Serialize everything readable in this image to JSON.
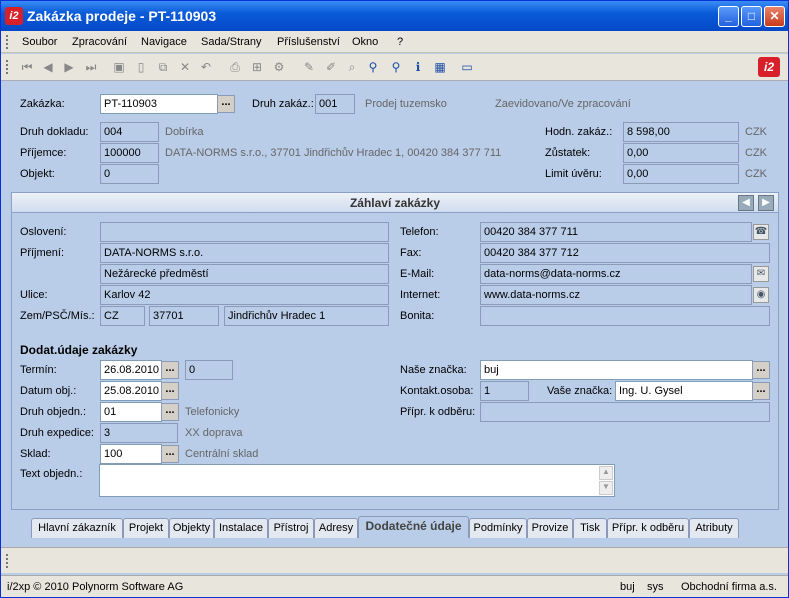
{
  "window": {
    "title": "Zakázka prodeje - PT-110903",
    "logo": "i2"
  },
  "menu": [
    "Soubor",
    "Zpracování",
    "Navigace",
    "Sada/Strany",
    "Příslušenství",
    "Okno",
    "?"
  ],
  "top": {
    "zakazka_label": "Zakázka:",
    "zakazka_value": "PT-110903",
    "druh_zakaz_label": "Druh zakáz.:",
    "druh_zakaz_value": "001",
    "druh_zakaz_text": "Prodej tuzemsko",
    "status_text": "Zaevidovano/Ve zpracování",
    "druh_dokladu_label": "Druh dokladu:",
    "druh_dokladu_value": "004",
    "druh_dokladu_text": "Dobírka",
    "prijemce_label": "Příjemce:",
    "prijemce_value": "100000",
    "prijemce_text": "DATA-NORMS s.r.o., 37701 Jindřichův Hradec 1, 00420 384 377 711",
    "objekt_label": "Objekt:",
    "objekt_value": "0",
    "hodn_label": "Hodn. zakáz.:",
    "hodn_value": "8 598,00",
    "hodn_cur": "CZK",
    "zustatek_label": "Zůstatek:",
    "zustatek_value": "0,00",
    "zustatek_cur": "CZK",
    "limit_label": "Limit úvěru:",
    "limit_value": "0,00",
    "limit_cur": "CZK"
  },
  "panel": {
    "title": "Záhlaví zakázky",
    "osloveni_label": "Oslovení:",
    "osloveni_value": "",
    "prijmeni_label": "Příjmení:",
    "prijmeni_value": "DATA-NORMS s.r.o.",
    "prijmeni_value2": "Nežárecké předměstí",
    "ulice_label": "Ulice:",
    "ulice_value": "Karlov 42",
    "zem_label": "Zem/PSČ/Mís.:",
    "zem_value": "CZ",
    "psc_value": "37701",
    "misto_value": "Jindřichův Hradec 1",
    "telefon_label": "Telefon:",
    "telefon_value": "00420 384 377 711",
    "fax_label": "Fax:",
    "fax_value": "00420 384 377 712",
    "email_label": "E-Mail:",
    "email_value": "data-norms@data-norms.cz",
    "internet_label": "Internet:",
    "internet_value": "www.data-norms.cz",
    "bonita_label": "Bonita:",
    "bonita_value": "",
    "section_title": "Dodat.údaje zakázky",
    "termin_label": "Termín:",
    "termin_value": "26.08.2010",
    "termin_extra": "0",
    "datum_label": "Datum obj.:",
    "datum_value": "25.08.2010",
    "druh_obj_label": "Druh objedn.:",
    "druh_obj_value": "01",
    "druh_obj_text": "Telefonicky",
    "druh_exp_label": "Druh expedice:",
    "druh_exp_value": "3",
    "druh_exp_text": "XX doprava",
    "sklad_label": "Sklad:",
    "sklad_value": "100",
    "sklad_text": "Centrální sklad",
    "text_label": "Text objedn.:",
    "nase_label": "Naše značka:",
    "nase_value": "buj",
    "kontakt_label": "Kontakt.osoba:",
    "kontakt_value": "1",
    "vase_label": "Vaše značka:",
    "vase_value": "Ing. U. Gysel",
    "pripr_label": "Přípr. k odběru:",
    "pripr_value": ""
  },
  "tabs": [
    "Hlavní zákazník",
    "Projekt",
    "Objekty",
    "Instalace",
    "Přístroj",
    "Adresy",
    "Dodatečné údaje",
    "Podmínky",
    "Provize",
    "Tisk",
    "Přípr. k odběru",
    "Atributy"
  ],
  "status": {
    "copyright": "i/2xp © 2010 Polynorm Software AG",
    "user": "buj",
    "sys": "sys",
    "firm": "Obchodní firma a.s."
  }
}
